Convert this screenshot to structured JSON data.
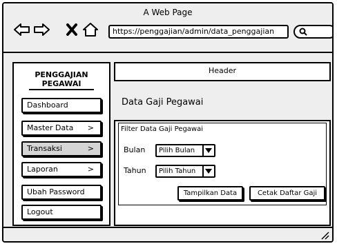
{
  "window": {
    "title": "A Web Page"
  },
  "nav": {
    "back_icon": "back-arrow-icon",
    "forward_icon": "forward-arrow-icon",
    "close_icon": "close-icon",
    "home_icon": "home-icon"
  },
  "address_bar": {
    "url": "https://penggajian/admin/data_penggajian"
  },
  "search": {
    "icon": "search-icon"
  },
  "sidebar": {
    "brand_line1": "PENGGAJIAN",
    "brand_line2": "PEGAWAI",
    "items": [
      {
        "label": "Dashboard",
        "has_submenu": false
      },
      {
        "label": "Master Data",
        "has_submenu": true
      },
      {
        "label": "Transaksi",
        "has_submenu": true,
        "active": true
      },
      {
        "label": "Laporan",
        "has_submenu": true
      },
      {
        "label": "Ubah Password",
        "has_submenu": false
      },
      {
        "label": "Logout",
        "has_submenu": false
      }
    ],
    "chevron": ">"
  },
  "header": {
    "label": "Header"
  },
  "main": {
    "title": "Data Gaji Pegawai",
    "filter": {
      "title": "Filter Data Gaji Pegawai",
      "bulan_label": "Bulan",
      "bulan_value": "Pilih Bulan",
      "tahun_label": "Tahun",
      "tahun_value": "Pilih Tahun",
      "show_button": "Tampilkan Data",
      "print_button": "Cetak Daftar Gaji"
    }
  },
  "colors": {
    "active_item_bg": "#d5d5d5",
    "chrome_bg": "#eeeeee"
  }
}
